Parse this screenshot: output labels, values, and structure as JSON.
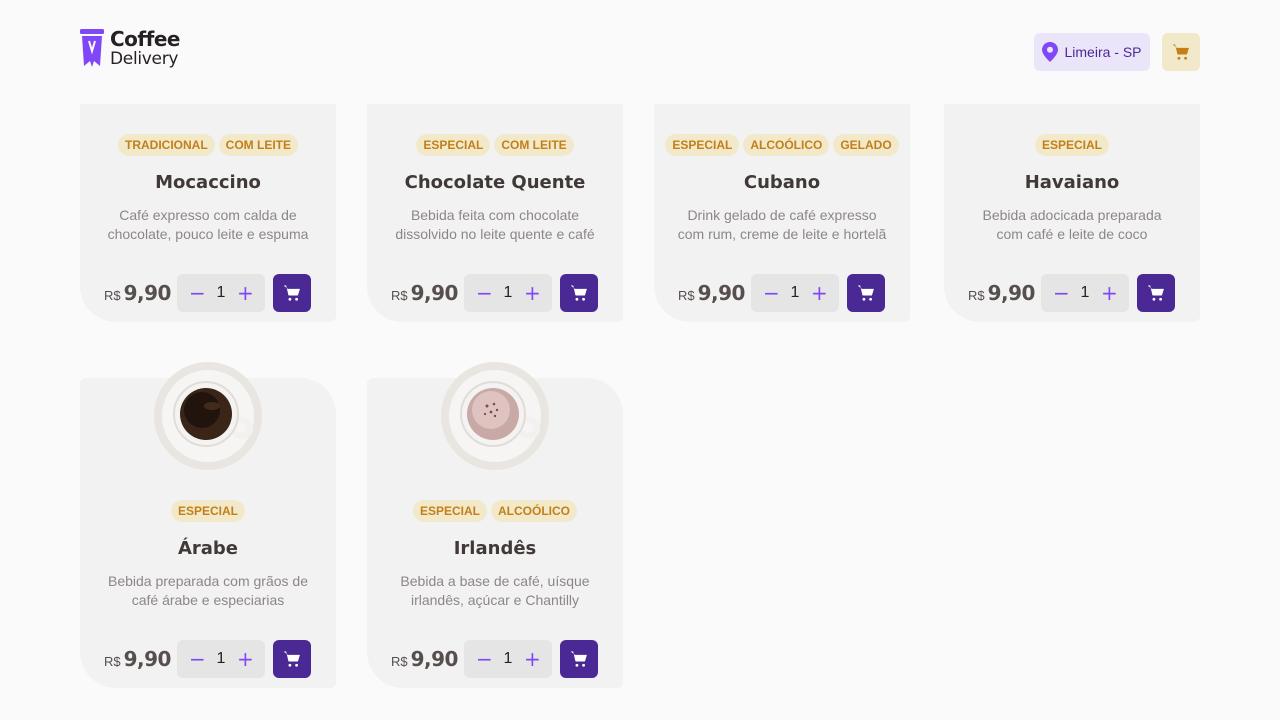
{
  "header": {
    "logo_line1": "Coffee",
    "logo_line2": "Delivery",
    "location": "Limeira - SP"
  },
  "colors": {
    "brand_purple": "#8047f8",
    "purple_dark": "#4b2995",
    "yellow": "#dbac2c",
    "yellow_dark": "#c47f17",
    "card_bg": "#f3f2f2"
  },
  "products": [
    {
      "name": "Mocaccino",
      "tags": [
        "TRADICIONAL",
        "COM LEITE"
      ],
      "desc_line1": "Café expresso com calda de",
      "desc_line2": "chocolate, pouco leite e espuma",
      "currency": "R$",
      "price": "9,90",
      "qty": "1"
    },
    {
      "name": "Chocolate Quente",
      "tags": [
        "ESPECIAL",
        "COM LEITE"
      ],
      "desc_line1": "Bebida feita com chocolate",
      "desc_line2": "dissolvido no leite quente e café",
      "currency": "R$",
      "price": "9,90",
      "qty": "1"
    },
    {
      "name": "Cubano",
      "tags": [
        "ESPECIAL",
        "ALCOÓLICO",
        "GELADO"
      ],
      "desc_line1": "Drink gelado de café expresso",
      "desc_line2": "com rum, creme de leite e hortelã",
      "currency": "R$",
      "price": "9,90",
      "qty": "1"
    },
    {
      "name": "Havaiano",
      "tags": [
        "ESPECIAL"
      ],
      "desc_line1": "Bebida adocicada preparada",
      "desc_line2": "com café e leite de coco",
      "currency": "R$",
      "price": "9,90",
      "qty": "1"
    },
    {
      "name": "Árabe",
      "tags": [
        "ESPECIAL"
      ],
      "desc_line1": "Bebida preparada com grãos de",
      "desc_line2": "café árabe e especiarias",
      "currency": "R$",
      "price": "9,90",
      "qty": "1"
    },
    {
      "name": "Irlandês",
      "tags": [
        "ESPECIAL",
        "ALCOÓLICO"
      ],
      "desc_line1": "Bebida a base de café, uísque",
      "desc_line2": "irlandês, açúcar e Chantilly",
      "currency": "R$",
      "price": "9,90",
      "qty": "1"
    }
  ],
  "icons": {
    "logo": "coffee-cup-logo-icon",
    "location": "map-pin-icon",
    "cart": "shopping-cart-icon",
    "minus": "minus-icon",
    "plus": "plus-icon"
  }
}
